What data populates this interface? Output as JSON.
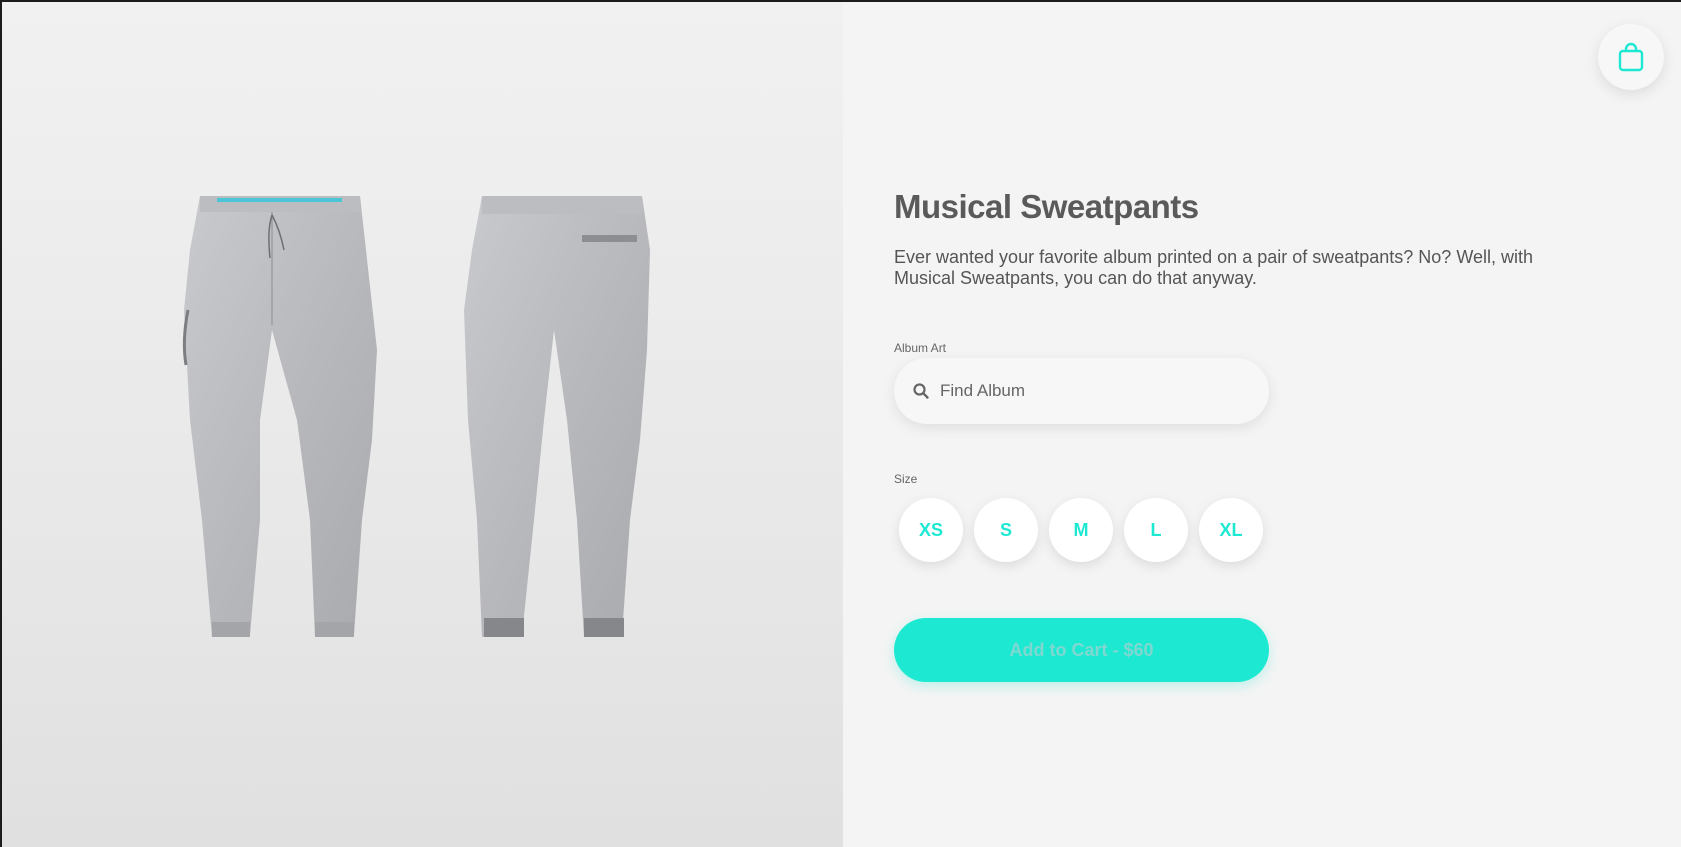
{
  "product": {
    "title": "Musical Sweatpants",
    "description": "Ever wanted your favorite album printed on a pair of sweatpants? No? Well, with Musical Sweatpants, you can do that anyway."
  },
  "album_art": {
    "label": "Album Art",
    "placeholder": "Find Album",
    "value": ""
  },
  "size": {
    "label": "Size",
    "options": [
      "XS",
      "S",
      "M",
      "L",
      "XL"
    ]
  },
  "cart": {
    "button_label": "Add to Cart - $60",
    "icon": "shopping-bag-icon"
  },
  "colors": {
    "accent": "#1de9d3",
    "title": "#5a5a5a",
    "background": "#f4f4f4"
  }
}
